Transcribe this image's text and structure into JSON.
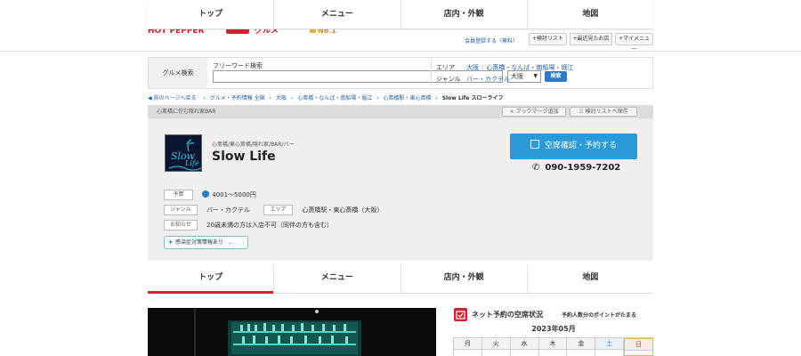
{
  "nav": {
    "tabs": [
      "トップ",
      "メニュー",
      "店内・外観",
      "地図"
    ]
  },
  "header": {
    "logo_text": "HOT PEPPER グルメ",
    "badge": "No.1",
    "register_link": "会員登録する（無料）",
    "buttons": [
      "検討リスト",
      "最近見たお店",
      "マイメニュー"
    ]
  },
  "search": {
    "section_label": "グルメ検索",
    "freeword_label": "フリーワード検索",
    "freeword_value": "",
    "area_select": "大阪",
    "submit_label": "検索",
    "area_label": "エリア",
    "area_links": [
      "大阪",
      "心斎橋・なんば・南船場・堀江"
    ],
    "genre_label": "ジャンル",
    "genre_value": "バー・カクテル"
  },
  "breadcrumb": {
    "back": "前のページへ戻る",
    "items": [
      "グルメ・予約情報 全国",
      "大阪",
      "心斎橋・なんば・南船場・堀江",
      "心斎橋駅・東心斎橋"
    ],
    "current": "Slow Life スローライフ"
  },
  "shop": {
    "caption": "心斎橋に佇む隠れ家BAR",
    "bookmark_label": "ブックマーク追加",
    "compare_label": "検討リストへ保存",
    "category": "心斎橋/東心斎橋/隠れ家/BAR/バー",
    "name": "Slow Life",
    "reserve_label": "空席確認・予約する",
    "phone": "090-1959-7202",
    "budget_label": "予算",
    "budget_value": "4001～5000円",
    "genre_label": "ジャンル",
    "genre_value": "バー・カクテル",
    "area_label": "エリア",
    "area_value": "心斎橋駅・東心斎橋（大阪）",
    "notice_label": "お知らせ",
    "notice_value": "20歳未満の方は入店不可（同伴の方も含む）",
    "infection_label": "感染症対策情報あり"
  },
  "calendar": {
    "title": "ネット予約の空席状況",
    "note": "予約人数分のポイントがたまる",
    "month": "2023年05月",
    "weekdays": [
      "月",
      "火",
      "水",
      "木",
      "金",
      "土",
      "日"
    ]
  },
  "colors": {
    "accent_red": "#d5212e",
    "reserve_blue": "#2a9bd8",
    "link_blue": "#1a5fa8"
  }
}
